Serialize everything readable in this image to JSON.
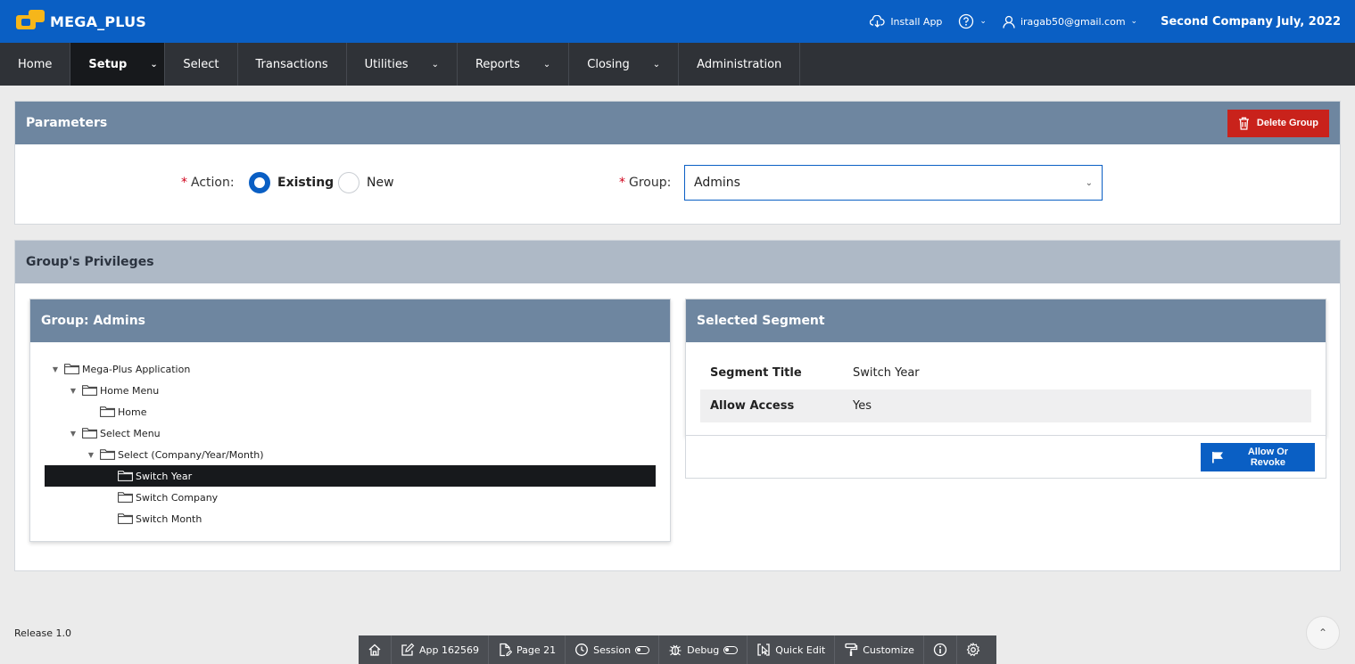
{
  "app": {
    "name": "MEGA_PLUS"
  },
  "header": {
    "install_app": "Install App",
    "user_email": "iragab50@gmail.com",
    "company_period": "Second Company July, 2022"
  },
  "menu": {
    "home": "Home",
    "setup": "Setup",
    "select": "Select",
    "transactions": "Transactions",
    "utilities": "Utilities",
    "reports": "Reports",
    "closing": "Closing",
    "administration": "Administration"
  },
  "parameters": {
    "title": "Parameters",
    "delete_group": "Delete Group",
    "action_label": "Action:",
    "option_existing": "Existing",
    "option_new": "New",
    "selected_option": "Existing",
    "group_label": "Group:",
    "group_value": "Admins",
    "required_mark": "*"
  },
  "privileges": {
    "title": "Group's Privileges",
    "tree_panel_title": "Group: Admins",
    "tree": [
      {
        "label": "Mega-Plus Application",
        "level": 0,
        "expanded": true
      },
      {
        "label": "Home Menu",
        "level": 1,
        "expanded": true
      },
      {
        "label": "Home",
        "level": 2
      },
      {
        "label": "Select Menu",
        "level": 1,
        "expanded": true
      },
      {
        "label": "Select (Company/Year/Month)",
        "level": 2,
        "expanded": true
      },
      {
        "label": "Switch Year",
        "level": 3,
        "selected": true
      },
      {
        "label": "Switch Company",
        "level": 3
      },
      {
        "label": "Switch Month",
        "level": 3
      }
    ],
    "segment_panel_title": "Selected Segment",
    "segment_title_key": "Segment Title",
    "segment_title_value": "Switch Year",
    "allow_access_key": "Allow Access",
    "allow_access_value": "Yes",
    "allow_button": "Allow Or Revoke"
  },
  "footer": {
    "release": "Release 1.0",
    "devbar": {
      "app": "App 162569",
      "page": "Page 21",
      "session": "Session",
      "debug": "Debug",
      "quick_edit": "Quick Edit",
      "customize": "Customize"
    }
  },
  "colors": {
    "brand_blue": "#0a5fc4",
    "menu_dark": "#2f3237",
    "panel_head": "#6e86a0",
    "danger": "#c9221b",
    "logo_gold": "#f6b61a"
  }
}
